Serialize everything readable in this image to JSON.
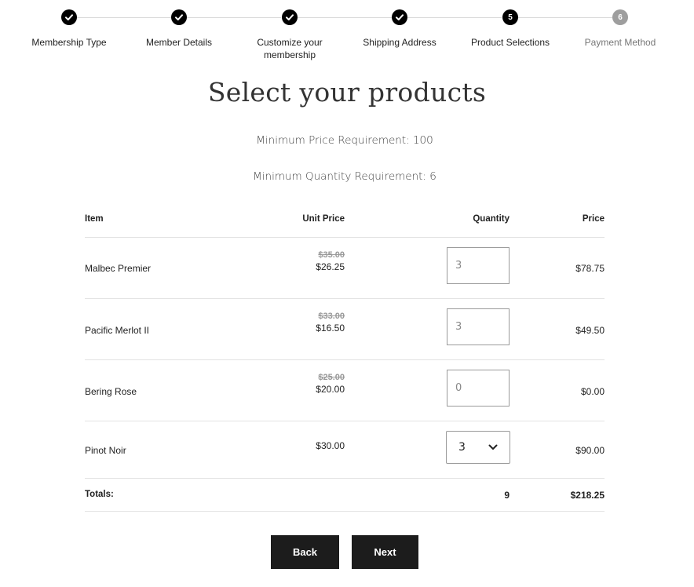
{
  "stepper": {
    "steps": [
      {
        "label": "Membership Type",
        "status": "done",
        "icon": "check-icon"
      },
      {
        "label": "Member Details",
        "status": "done",
        "icon": "check-icon"
      },
      {
        "label": "Customize your membership",
        "status": "done",
        "icon": "check-icon"
      },
      {
        "label": "Shipping Address",
        "status": "done",
        "icon": "check-icon"
      },
      {
        "label": "Product Selections",
        "status": "current",
        "number": "5"
      },
      {
        "label": "Payment Method",
        "status": "pending",
        "number": "6"
      }
    ],
    "colors": {
      "active": "#000000",
      "pending": "#9e9e9e",
      "line": "#d9d9d9"
    }
  },
  "page": {
    "title": "Select your products",
    "min_price": "Minimum Price Requirement: 100",
    "min_quantity": "Minimum Quantity Requirement: 6"
  },
  "table": {
    "headers": {
      "item": "Item",
      "unit_price": "Unit Price",
      "quantity": "Quantity",
      "price": "Price"
    },
    "rows": [
      {
        "item": "Malbec Premier",
        "old_price": "$35.00",
        "unit_price": "$26.25",
        "quantity": "3",
        "price": "$78.75",
        "control": "input"
      },
      {
        "item": "Pacific Merlot II",
        "old_price": "$33.00",
        "unit_price": "$16.50",
        "quantity": "3",
        "price": "$49.50",
        "control": "input"
      },
      {
        "item": "Bering Rose",
        "old_price": "$25.00",
        "unit_price": "$20.00",
        "quantity": "0",
        "price": "$0.00",
        "control": "input"
      },
      {
        "item": "Pinot Noir",
        "old_price": "",
        "unit_price": "$30.00",
        "quantity": "3",
        "price": "$90.00",
        "control": "select"
      }
    ],
    "totals": {
      "label": "Totals:",
      "quantity": "9",
      "price": "$218.25"
    }
  },
  "buttons": {
    "back": "Back",
    "next": "Next",
    "color": "#1c1c1c"
  }
}
